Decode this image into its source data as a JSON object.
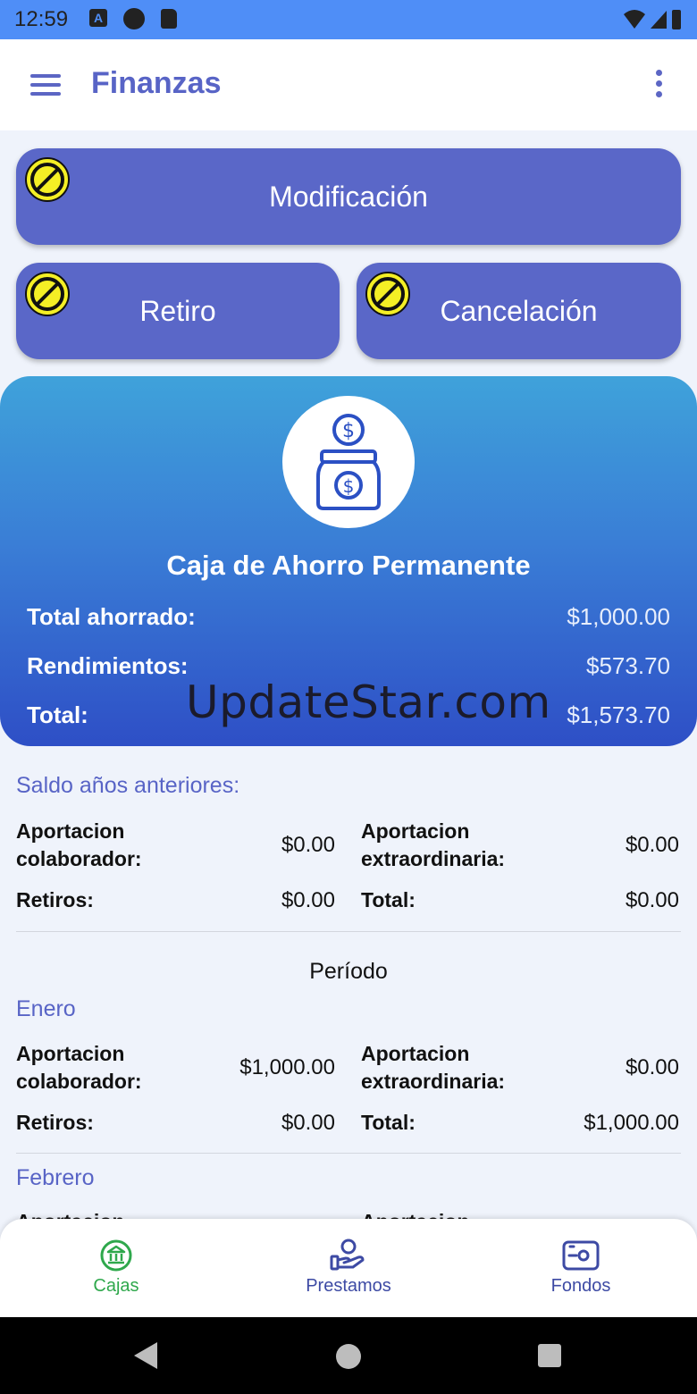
{
  "status_bar": {
    "time": "12:59",
    "a_badge": "A"
  },
  "app_bar": {
    "title": "Finanzas"
  },
  "actions": {
    "modificacion": "Modificación",
    "retiro": "Retiro",
    "cancelacion": "Cancelación"
  },
  "card": {
    "title": "Caja de Ahorro Permanente",
    "rows": [
      {
        "label": "Total ahorrado:",
        "value": "$1,000.00"
      },
      {
        "label": "Rendimientos:",
        "value": "$573.70"
      },
      {
        "label": "Total:",
        "value": "$1,573.70"
      }
    ],
    "watermark": "UpdateStar.com"
  },
  "previous": {
    "title": "Saldo años anteriores:",
    "aport_colab_label": "Aportacion\ncolaborador:",
    "aport_colab_value": "$0.00",
    "aport_extra_label": "Aportacion\nextraordinaria:",
    "aport_extra_value": "$0.00",
    "retiros_label": "Retiros:",
    "retiros_value": "$0.00",
    "total_label": "Total:",
    "total_value": "$0.00"
  },
  "periodo_label": "Período",
  "months": [
    {
      "name": "Enero",
      "aport_colab_label": "Aportacion\ncolaborador:",
      "aport_colab_value": "$1,000.00",
      "aport_extra_label": "Aportacion\nextraordinaria:",
      "aport_extra_value": "$0.00",
      "retiros_label": "Retiros:",
      "retiros_value": "$0.00",
      "total_label": "Total:",
      "total_value": "$1,000.00"
    },
    {
      "name": "Febrero",
      "aport_colab_label": "Aportacion",
      "aport_extra_label": "Aportacion"
    }
  ],
  "bottom_nav": {
    "cajas": "Cajas",
    "prestamos": "Prestamos",
    "fondos": "Fondos"
  },
  "colors": {
    "accent": "#5a67c8",
    "active_tab": "#2fa84c",
    "status_bar": "#4f8ef7"
  }
}
